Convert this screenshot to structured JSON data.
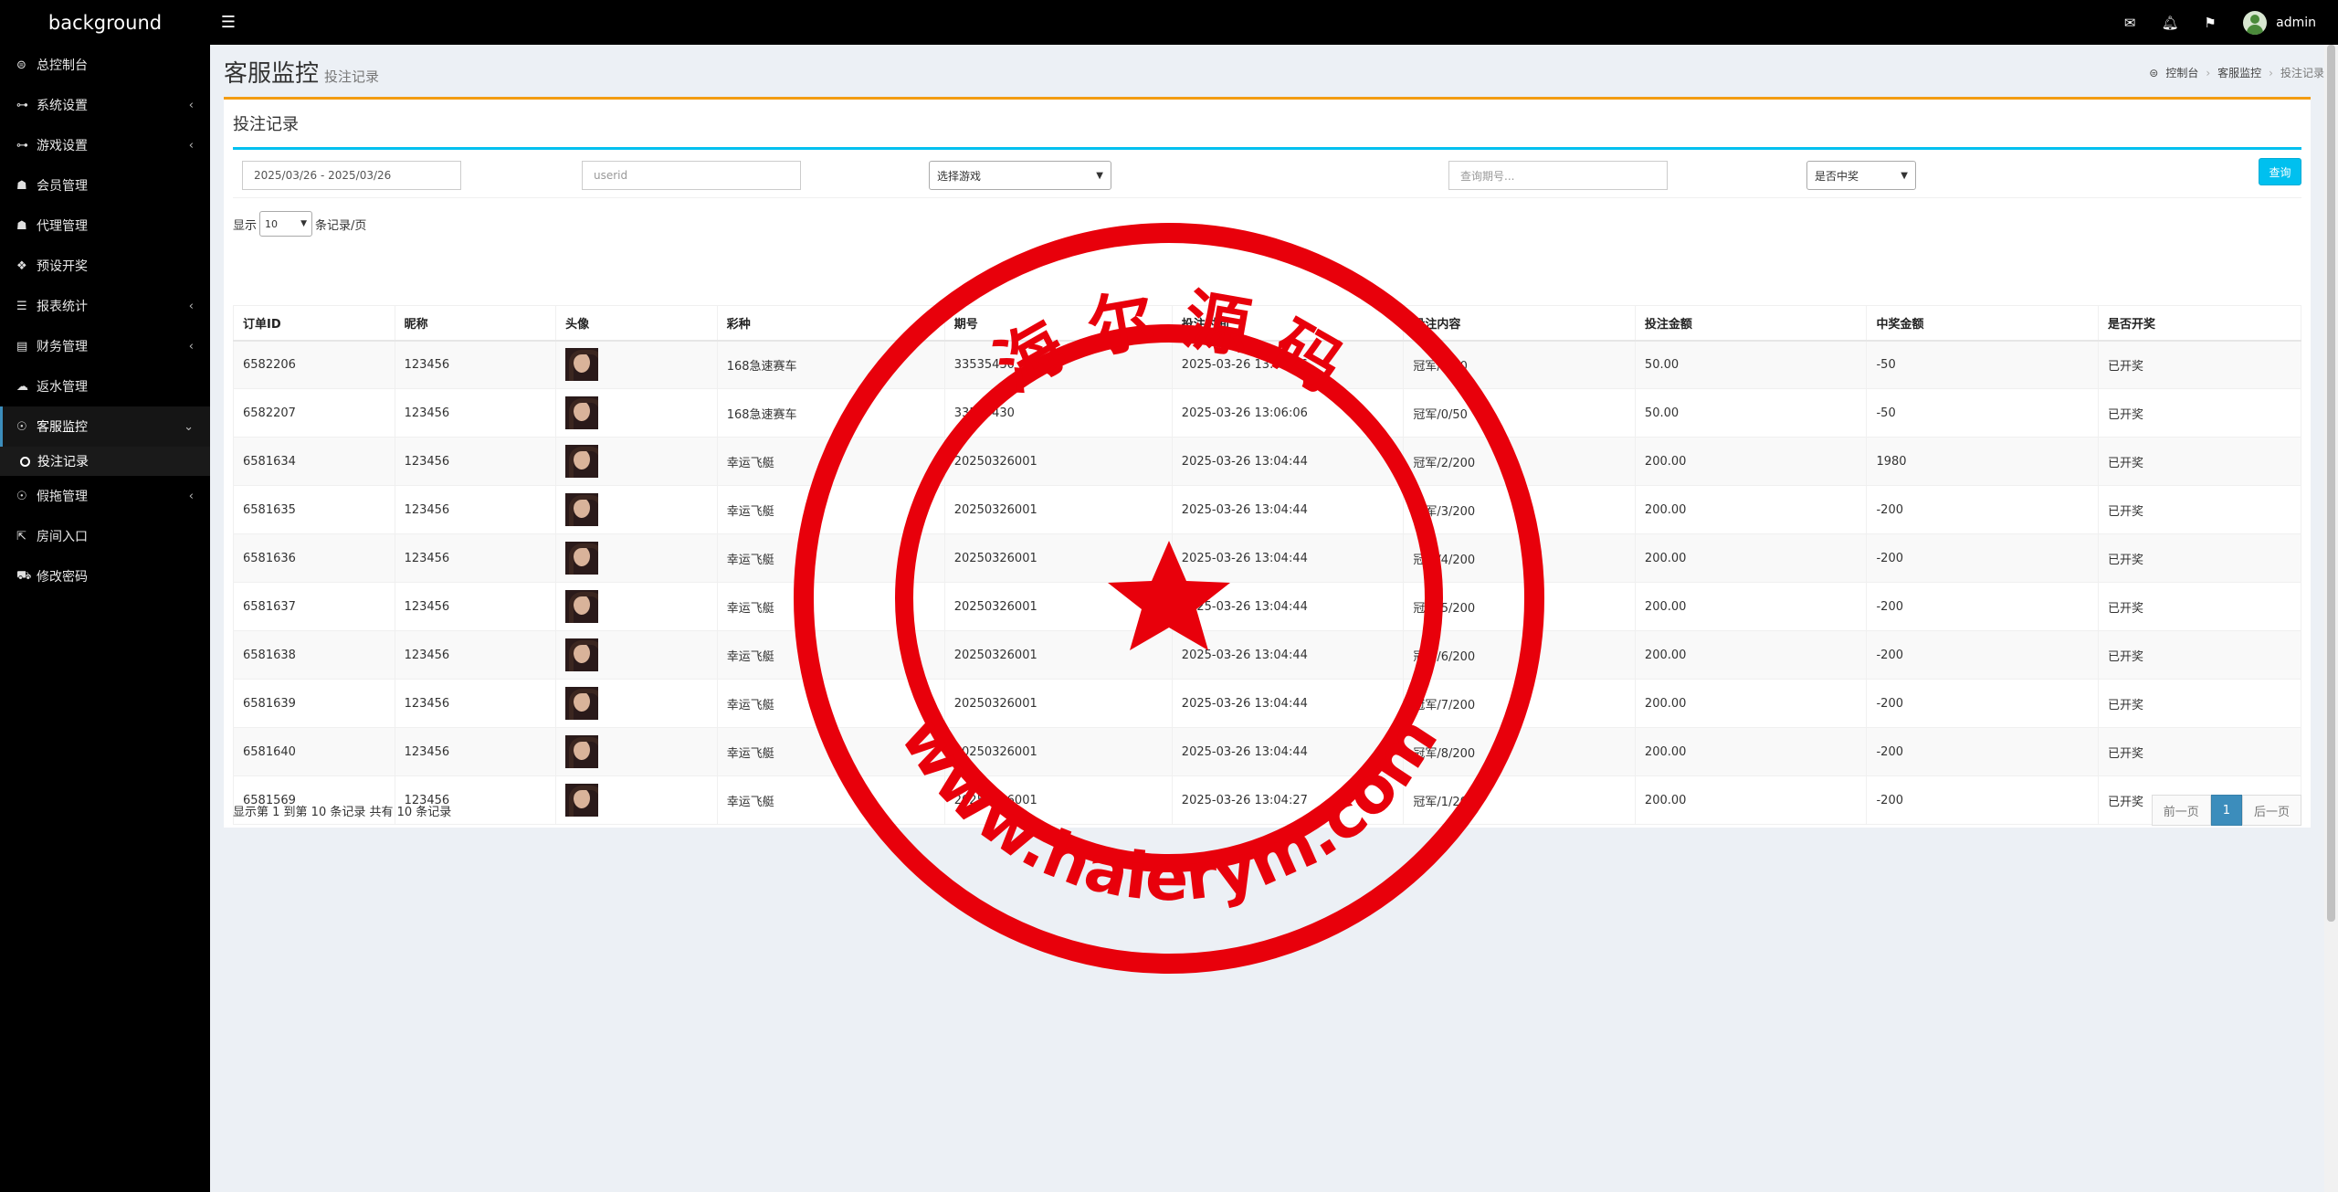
{
  "topbar": {
    "brand": "background",
    "username": "admin"
  },
  "sidebar": {
    "items": [
      {
        "label": "总控制台",
        "icon": "dashboard-icon",
        "glyph": "⊜",
        "arrow": ""
      },
      {
        "label": "系统设置",
        "icon": "link-icon",
        "glyph": "⊶",
        "arrow": "‹"
      },
      {
        "label": "游戏设置",
        "icon": "link-icon",
        "glyph": "⊶",
        "arrow": "‹"
      },
      {
        "label": "会员管理",
        "icon": "users-icon",
        "glyph": "☗",
        "arrow": ""
      },
      {
        "label": "代理管理",
        "icon": "users-icon",
        "glyph": "☗",
        "arrow": ""
      },
      {
        "label": "预设开奖",
        "icon": "cubes-icon",
        "glyph": "❖",
        "arrow": ""
      },
      {
        "label": "报表统计",
        "icon": "list-icon",
        "glyph": "☰",
        "arrow": "‹"
      },
      {
        "label": "财务管理",
        "icon": "database-icon",
        "glyph": "▤",
        "arrow": "‹"
      },
      {
        "label": "返水管理",
        "icon": "cloud-icon",
        "glyph": "☁",
        "arrow": ""
      },
      {
        "label": "客服监控",
        "icon": "comments-icon",
        "glyph": "☉",
        "arrow": "⌄"
      },
      {
        "label": "假拖管理",
        "icon": "comment-icon",
        "glyph": "☉",
        "arrow": "‹"
      },
      {
        "label": "房间入口",
        "icon": "external-link-icon",
        "glyph": "⇱",
        "arrow": ""
      },
      {
        "label": "修改密码",
        "icon": "cart-icon",
        "glyph": "⛟",
        "arrow": ""
      }
    ],
    "subitem": "投注记录"
  },
  "header": {
    "title": "客服监控",
    "subtitle": "投注记录",
    "breadcrumb": [
      "控制台",
      "客服监控",
      "投注记录"
    ]
  },
  "box": {
    "title": "投注记录"
  },
  "filters": {
    "date_range": "2025/03/26 - 2025/03/26",
    "userid_placeholder": "userid",
    "game_select": "选择游戏",
    "issue_placeholder": "查询期号...",
    "win_select": "是否中奖",
    "query_button": "查询"
  },
  "length": {
    "prefix": "显示",
    "value": "10",
    "suffix": "条记录/页"
  },
  "table": {
    "headers": [
      "订单ID",
      "昵称",
      "头像",
      "彩种",
      "期号",
      "投注时间",
      "投注内容",
      "投注金额",
      "中奖金额",
      "是否开奖"
    ],
    "rows": [
      [
        "6582206",
        "123456",
        "",
        "168急速赛车",
        "33535430",
        "2025-03-26 13:06:06",
        "冠军/1/50",
        "50.00",
        "-50",
        "已开奖"
      ],
      [
        "6582207",
        "123456",
        "",
        "168急速赛车",
        "33535430",
        "2025-03-26 13:06:06",
        "冠军/0/50",
        "50.00",
        "-50",
        "已开奖"
      ],
      [
        "6581634",
        "123456",
        "",
        "幸运飞艇",
        "20250326001",
        "2025-03-26 13:04:44",
        "冠军/2/200",
        "200.00",
        "1980",
        "已开奖"
      ],
      [
        "6581635",
        "123456",
        "",
        "幸运飞艇",
        "20250326001",
        "2025-03-26 13:04:44",
        "冠军/3/200",
        "200.00",
        "-200",
        "已开奖"
      ],
      [
        "6581636",
        "123456",
        "",
        "幸运飞艇",
        "20250326001",
        "2025-03-26 13:04:44",
        "冠军/4/200",
        "200.00",
        "-200",
        "已开奖"
      ],
      [
        "6581637",
        "123456",
        "",
        "幸运飞艇",
        "20250326001",
        "2025-03-26 13:04:44",
        "冠军/5/200",
        "200.00",
        "-200",
        "已开奖"
      ],
      [
        "6581638",
        "123456",
        "",
        "幸运飞艇",
        "20250326001",
        "2025-03-26 13:04:44",
        "冠军/6/200",
        "200.00",
        "-200",
        "已开奖"
      ],
      [
        "6581639",
        "123456",
        "",
        "幸运飞艇",
        "20250326001",
        "2025-03-26 13:04:44",
        "冠军/7/200",
        "200.00",
        "-200",
        "已开奖"
      ],
      [
        "6581640",
        "123456",
        "",
        "幸运飞艇",
        "20250326001",
        "2025-03-26 13:04:44",
        "冠军/8/200",
        "200.00",
        "-200",
        "已开奖"
      ],
      [
        "6581569",
        "123456",
        "",
        "幸运飞艇",
        "20250326001",
        "2025-03-26 13:04:27",
        "冠军/1/200",
        "200.00",
        "-200",
        "已开奖"
      ]
    ]
  },
  "footer": {
    "info": "显示第 1 到第 10 条记录 共有 10 条记录",
    "prev": "前一页",
    "page": "1",
    "next": "后一页"
  },
  "stamp": {
    "top_text": "海 尔 源 码",
    "bottom_text": "www.haierym.com",
    "color": "#e8000b"
  }
}
